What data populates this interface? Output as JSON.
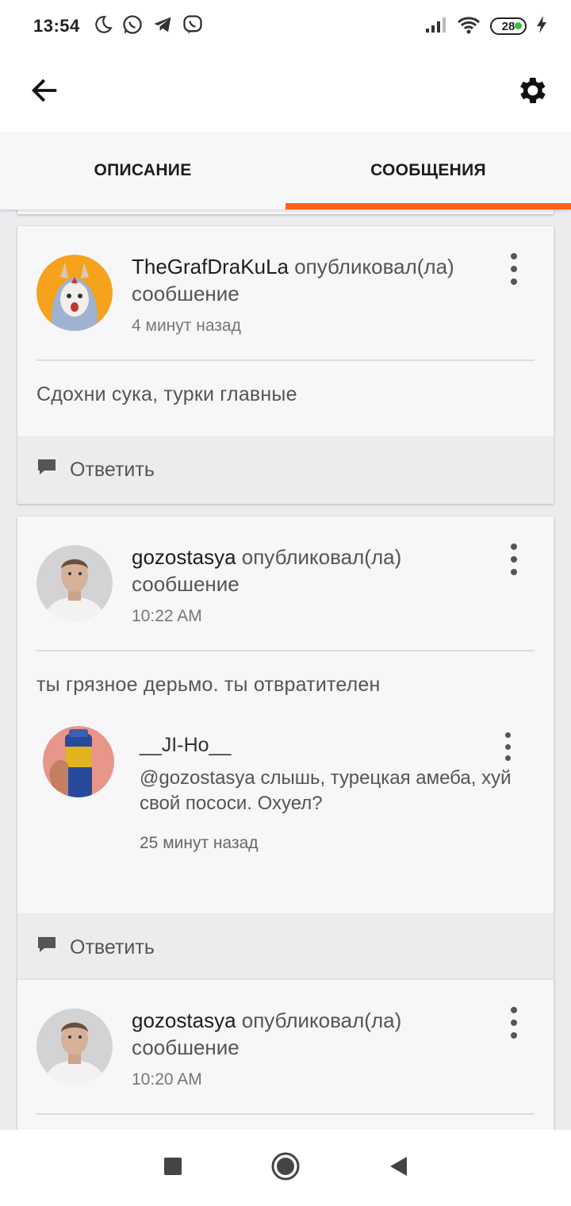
{
  "status_bar": {
    "time": "13:54",
    "battery": "28",
    "icons": [
      "moon-icon",
      "whatsapp-icon",
      "telegram-icon",
      "viber-icon",
      "signal-icon",
      "wifi-icon",
      "charging-icon"
    ]
  },
  "app_bar": {
    "icons": [
      "back-arrow-icon",
      "gear-icon"
    ]
  },
  "tabs": [
    {
      "label": "ОПИСАНИЕ",
      "active": false
    },
    {
      "label": "СООБЩЕНИЯ",
      "active": true
    }
  ],
  "accent_color": "#ff6315",
  "posts": [
    {
      "username": "TheGrafDraKuLa",
      "action": "опубликовал(ла) сообшение",
      "time": "4 минут назад",
      "message": "Сдохни сука,  турки главные",
      "reply_label": "Ответить"
    },
    {
      "username": "gozostasya",
      "action": "опубликовал(ла) сообшение",
      "time": "10:22 AM",
      "message": "ты грязное дерьмо. ты отвратителен",
      "reply": {
        "username": "__JI-Ho__",
        "text": "@gozostasya  слышь, турецкая амеба, хуй свой пососи. Охуел?",
        "time": "25 минут назад"
      },
      "reply_label": "Ответить"
    },
    {
      "username": "gozostasya",
      "action": "опубликовал(ла) сообшение",
      "time": "10:20 AM"
    }
  ],
  "nav_bar": {
    "icons": [
      "recents-square-icon",
      "home-circle-icon",
      "back-triangle-icon"
    ]
  }
}
